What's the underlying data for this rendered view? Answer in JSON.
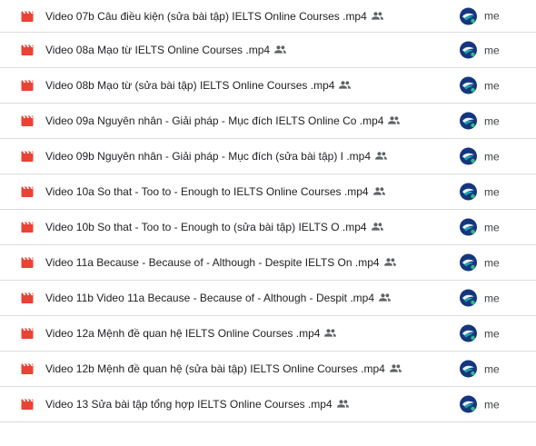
{
  "files": [
    {
      "name": "Video 07b Câu điều kiện (sửa bài tập) IELTS Online Courses .mp4",
      "owner": "me",
      "icon": "video-file-icon",
      "shared": true
    },
    {
      "name": "Video 08a Mạo từ IELTS Online Courses .mp4",
      "owner": "me",
      "icon": "video-file-icon",
      "shared": true
    },
    {
      "name": "Video 08b Mạo từ (sửa bài tập) IELTS Online Courses .mp4",
      "owner": "me",
      "icon": "video-file-icon",
      "shared": true
    },
    {
      "name": "Video 09a Nguyên nhân - Giải pháp - Mục đích IELTS Online Co .mp4",
      "owner": "me",
      "icon": "video-file-icon",
      "shared": true
    },
    {
      "name": "Video 09b Nguyên nhân - Giải pháp - Mục đích (sửa bài tập) I .mp4",
      "owner": "me",
      "icon": "video-file-icon",
      "shared": true
    },
    {
      "name": "Video 10a So that - Too to - Enough to IELTS Online Courses .mp4",
      "owner": "me",
      "icon": "video-file-icon",
      "shared": true
    },
    {
      "name": "Video 10b So that - Too to - Enough to (sửa bài tập) IELTS O .mp4",
      "owner": "me",
      "icon": "video-file-icon",
      "shared": true
    },
    {
      "name": "Video 11a Because - Because of - Although - Despite IELTS On .mp4",
      "owner": "me",
      "icon": "video-file-icon",
      "shared": true
    },
    {
      "name": "Video 11b Video 11a Because - Because of - Although - Despit .mp4",
      "owner": "me",
      "icon": "video-file-icon",
      "shared": true
    },
    {
      "name": "Video 12a Mệnh đề quan hệ IELTS Online Courses .mp4",
      "owner": "me",
      "icon": "video-file-icon",
      "shared": true
    },
    {
      "name": "Video 12b Mệnh đề quan hệ (sửa bài tập) IELTS Online Courses .mp4",
      "owner": "me",
      "icon": "video-file-icon",
      "shared": true
    },
    {
      "name": "Video 13 Sửa bài tập tổng hợp IELTS Online Courses .mp4",
      "owner": "me",
      "icon": "video-file-icon",
      "shared": true
    }
  ],
  "colors": {
    "video_icon": "#ea4335",
    "shared_icon": "#5f6368",
    "avatar_bg": "#14367e",
    "divider": "#dadce0"
  }
}
